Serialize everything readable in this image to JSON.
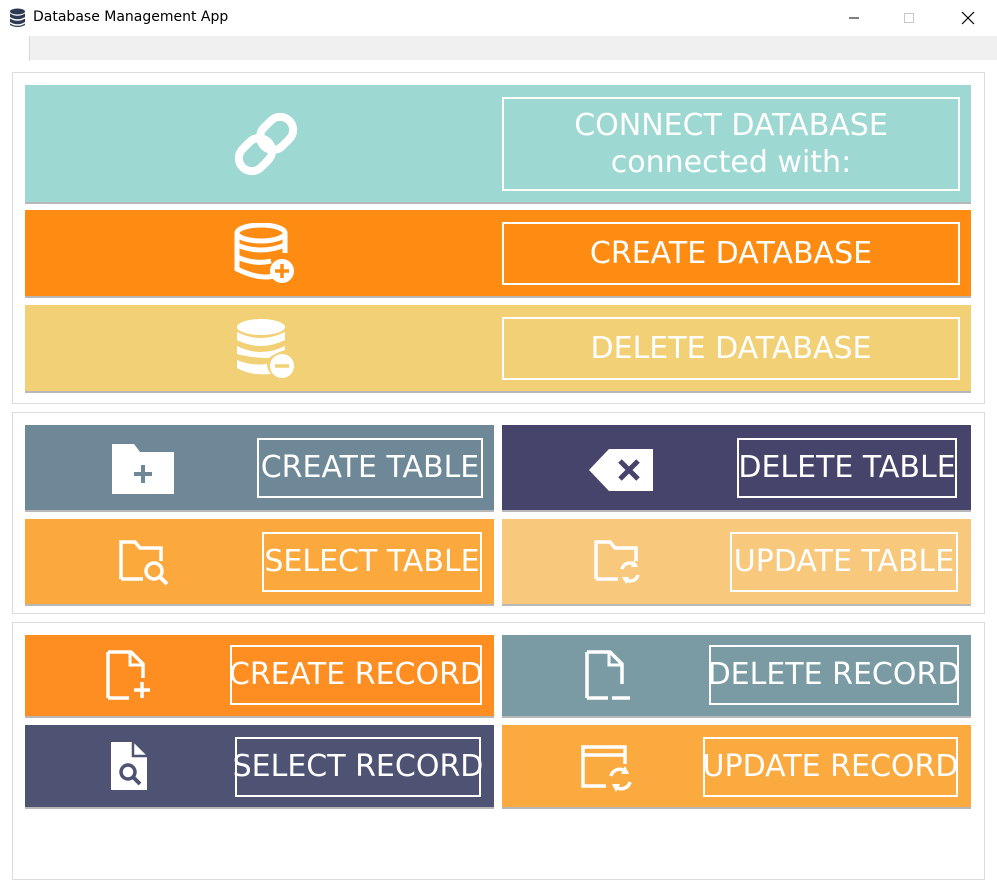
{
  "window": {
    "title": "Database Management App",
    "app_icon": "database-stack-icon",
    "controls": [
      "minimize-icon",
      "maximize-icon",
      "close-icon"
    ]
  },
  "database_group": {
    "connect": {
      "line1": "CONNECT DATABASE",
      "line2": "connected with:",
      "icon": "link-chain-icon",
      "color": "#9dd9d2"
    },
    "create": {
      "label": "CREATE DATABASE",
      "icon": "database-add-icon",
      "color": "#fe8c12"
    },
    "delete": {
      "label": "DELETE DATABASE",
      "icon": "database-remove-icon",
      "color": "#f2d076"
    }
  },
  "table_group": {
    "create": {
      "label": "CREATE TABLE",
      "icon": "folder-add-icon",
      "color": "#6e8898"
    },
    "delete": {
      "label": "DELETE TABLE",
      "icon": "backspace-delete-icon",
      "color": "#46446a"
    },
    "select": {
      "label": "SELECT TABLE",
      "icon": "folder-search-icon",
      "color": "#fba83d"
    },
    "update": {
      "label": "UPDATE TABLE",
      "icon": "folder-sync-icon",
      "color": "#f8c87c"
    }
  },
  "record_group": {
    "create": {
      "label": "CREATE RECORD",
      "icon": "file-add-icon",
      "color": "#fe8e22"
    },
    "delete": {
      "label": "DELETE RECORD",
      "icon": "file-remove-icon",
      "color": "#7a9ba4"
    },
    "select": {
      "label": "SELECT RECORD",
      "icon": "file-search-icon",
      "color": "#4f5373"
    },
    "update": {
      "label": "UPDATE RECORD",
      "icon": "window-sync-icon",
      "color": "#fbaa40"
    }
  }
}
